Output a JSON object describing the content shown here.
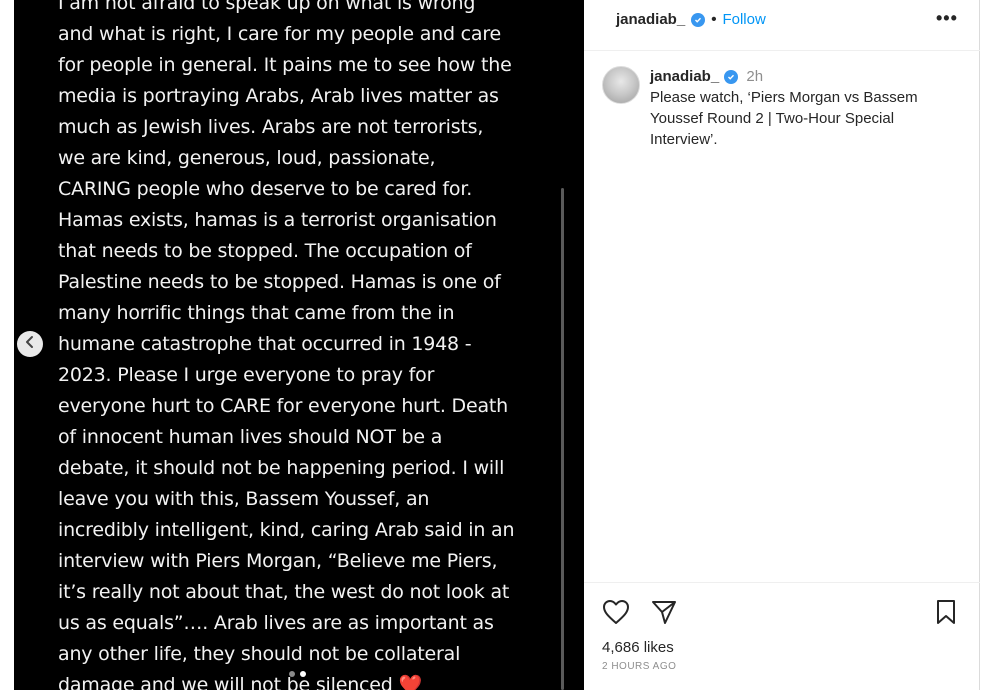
{
  "media": {
    "text": "I am not afraid to speak up on what is wrong\nand what is right, I care for my people and care\nfor people in general. It pains me to see how the\nmedia is portraying Arabs, Arab lives matter as\nmuch as Jewish lives. Arabs are not terrorists,\nwe are kind, generous, loud, passionate,\nCARING people who deserve to be cared for.\nHamas exists, hamas is a terrorist organisation\nthat needs to be stopped. The occupation of\nPalestine needs to be stopped. Hamas is one of\nmany horrific things that came from the in\nhumane catastrophe that occurred in 1948 -\n2023. Please I urge everyone to pray for\neveryone hurt to CARE for everyone hurt. Death\nof innocent human lives should NOT be a\ndebate, it should not be happening period. I will\nleave you with this, Bassem Youssef, an\nincredibly intelligent, kind, caring Arab said in an\ninterview with Piers Morgan, “Believe me Piers,\nit’s really not about that, the west do not look at\nus as equals”…. Arab lives are as important as\nany other life, they should not be collateral\ndamage and we will not be silenced ❤️",
    "prev_icon": "chevron-left-icon"
  },
  "header": {
    "username": "janadiab_",
    "separator": "•",
    "follow_label": "Follow",
    "more_label": "•••"
  },
  "comment": {
    "username": "janadiab_",
    "time": "2h",
    "text": "Please watch, ‘Piers Morgan vs Bassem Youssef Round 2 | Two-Hour Special Interview’."
  },
  "actions": {
    "likes": "4,686 likes",
    "time_ago": "2 HOURS AGO"
  },
  "colors": {
    "accent": "#0095f6",
    "verified": "#3897f0",
    "heart": "#e0162b"
  }
}
